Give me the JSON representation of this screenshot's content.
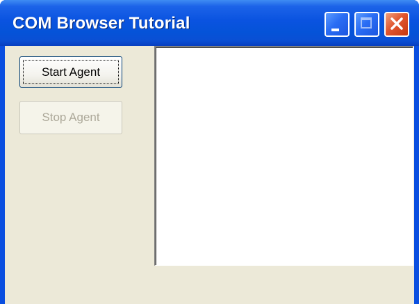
{
  "window": {
    "title": "COM Browser Tutorial"
  },
  "titlebar": {
    "buttons": [
      {
        "name": "minimize",
        "icon": "minimize-icon"
      },
      {
        "name": "maximize",
        "icon": "maximize-icon",
        "enabled": false
      },
      {
        "name": "close",
        "icon": "close-icon"
      }
    ]
  },
  "controls": {
    "start_agent_label": "Start Agent",
    "stop_agent_label": "Stop Agent",
    "stop_agent_enabled": false
  },
  "browser": {
    "content": ""
  },
  "colors": {
    "titlebar_blue": "#0553d8",
    "client_bg": "#ece9d8",
    "close_red": "#e0562f",
    "disabled_text": "#aca899"
  }
}
